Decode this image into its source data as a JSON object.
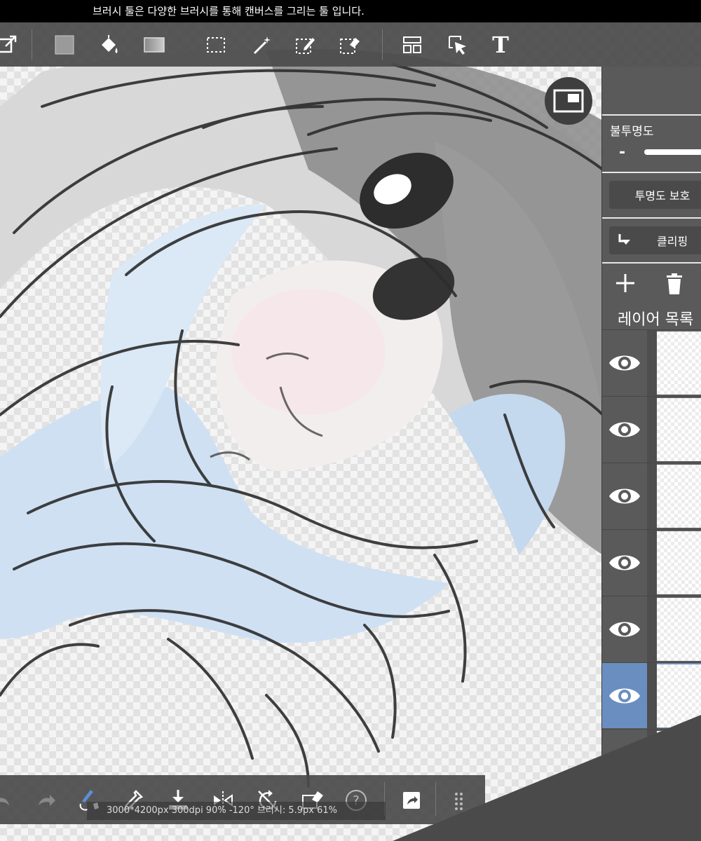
{
  "hint": {
    "text": "브러시 툴은 다양한 브러시를 통해 캔버스를 그리는 툴 입니다."
  },
  "toolbar": {
    "tools": [
      "canvas-menu",
      "color",
      "fill",
      "gradient",
      "select-rect",
      "magic-wand",
      "select-pen",
      "select-eraser",
      "layout",
      "move",
      "text"
    ],
    "text_tool_label": "T"
  },
  "panel": {
    "opacity_label": "불투명도",
    "opacity_minus": "-",
    "opacity_value": 1.0,
    "alpha_lock_label": "투명도 보호",
    "clipping_label": "클리핑",
    "layer_list_title": "레이어 목록",
    "layers": [
      {
        "visible": true,
        "selected": false
      },
      {
        "visible": true,
        "selected": false
      },
      {
        "visible": true,
        "selected": false
      },
      {
        "visible": true,
        "selected": false
      },
      {
        "visible": true,
        "selected": false
      },
      {
        "visible": true,
        "selected": true
      },
      {
        "visible": true,
        "selected": false
      }
    ]
  },
  "status": {
    "info": "3000*4200px 300dpi 90% -120° 브러시: 5.9px 61%"
  },
  "colors": {
    "toolbar_bg": "#4a4a4a",
    "panel_bg": "#5a5a5a",
    "selected_layer": "#6b8ec0",
    "brush_accent": "#5b8fd6"
  }
}
